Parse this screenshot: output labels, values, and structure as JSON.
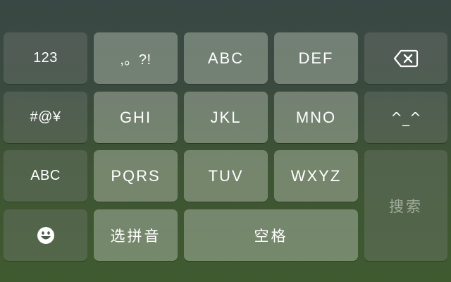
{
  "keyboard": {
    "row1": {
      "numbers": "123",
      "punct": ",。?!",
      "abc_key": "ABC",
      "def_key": "DEF"
    },
    "row2": {
      "symbols": "#@¥",
      "ghi_key": "GHI",
      "jkl_key": "JKL",
      "mno_key": "MNO",
      "kaomoji": "^_^"
    },
    "row3": {
      "abc_switch": "ABC",
      "pqrs_key": "PQRS",
      "tuv_key": "TUV",
      "wxyz_key": "WXYZ"
    },
    "row4": {
      "pinyin_select": "选拼音",
      "space": "空格"
    },
    "search": "搜索",
    "icons": {
      "delete": "backspace-icon",
      "emoji": "emoji-icon"
    },
    "colors": {
      "key_text": "#ffffff",
      "search_text": "#9aa598"
    }
  }
}
